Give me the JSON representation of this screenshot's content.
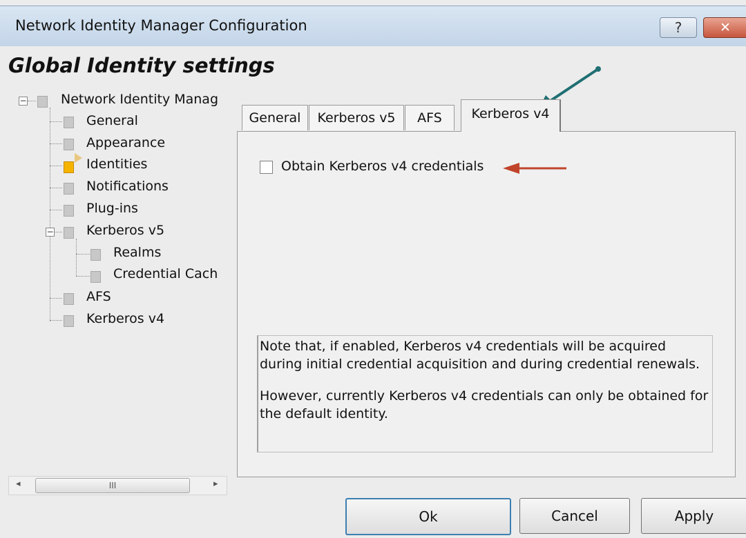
{
  "window": {
    "title": "Network Identity Manager Configuration",
    "help_label": "?",
    "close_label": "✕"
  },
  "heading": "Global Identity settings",
  "tree": {
    "items": [
      {
        "label": "Network Identity Manag"
      },
      {
        "label": "General"
      },
      {
        "label": "Appearance"
      },
      {
        "label": "Identities"
      },
      {
        "label": "Notifications"
      },
      {
        "label": "Plug-ins"
      },
      {
        "label": "Kerberos v5"
      },
      {
        "label": "Realms"
      },
      {
        "label": "Credential Cach"
      },
      {
        "label": "AFS"
      },
      {
        "label": "Kerberos v4"
      }
    ],
    "selected": "Identities"
  },
  "scrollbar": {
    "left_arrow": "◂",
    "right_arrow": "▸",
    "thumb_grip": "III"
  },
  "tabs": [
    {
      "label": "General"
    },
    {
      "label": "Kerberos v5"
    },
    {
      "label": "AFS"
    },
    {
      "label": "Kerberos v4"
    }
  ],
  "active_tab": "Kerberos v4",
  "checkbox": {
    "label": "Obtain Kerberos v4 credentials",
    "checked": false
  },
  "note": {
    "paragraph1": "Note that, if enabled, Kerberos v4 credentials will be acquired during initial credential acquisition and during credential renewals.",
    "paragraph2": "However, currently Kerberos v4 credentials can only be obtained for the default identity."
  },
  "buttons": {
    "ok": "Ok",
    "cancel": "Cancel",
    "apply": "Apply"
  },
  "colors": {
    "annotation_teal": "#1f6f73",
    "annotation_red": "#c0442a",
    "selected_node": "#f6b400"
  }
}
